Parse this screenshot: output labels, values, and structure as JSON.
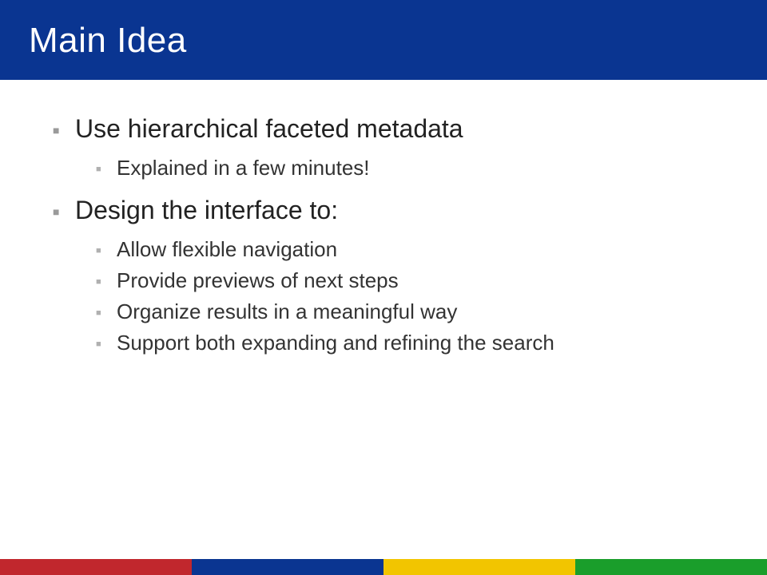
{
  "title": "Main Idea",
  "bullets": {
    "b1": "Use hierarchical faceted metadata",
    "b1_1": "Explained in a few minutes!",
    "b2": "Design the interface to:",
    "b2_1": "Allow flexible navigation",
    "b2_2": "Provide previews of next steps",
    "b2_3": "Organize results in a meaningful way",
    "b2_4": "Support both expanding and refining the search"
  },
  "stripe_colors": {
    "red": "#c1272d",
    "blue": "#0a3591",
    "yellow": "#f2c500",
    "green": "#1a9e2b"
  }
}
